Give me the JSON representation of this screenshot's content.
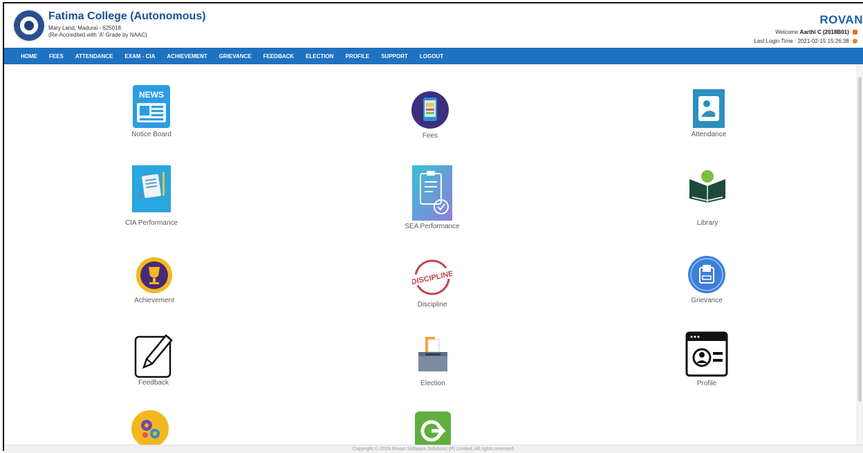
{
  "header": {
    "college_name": "Fatima College (Autonomous)",
    "address_line1": "Mary Land, Madurai - 625018.",
    "address_line2": "(Re-Accredited with 'A' Grade by NAAC)",
    "brand": "ROVAN",
    "welcome_prefix": "Welcome",
    "welcome_user": "Aarthi C (2018B01)",
    "last_login": "Last Login Time : 2021-02-15 15:26:38"
  },
  "nav": [
    "HOME",
    "FEES",
    "ATTENDANCE",
    "EXAM - CIA",
    "ACHIEVEMENT",
    "GRIEVANCE",
    "FEEDBACK",
    "ELECTION",
    "PROFILE",
    "SUPPORT",
    "LOGOUT"
  ],
  "tiles": {
    "notice_board": "Notice Board",
    "fees": "Fees",
    "attendance": "Attendance",
    "cia": "CIA Performance",
    "sea": "SEA Performance",
    "library": "Library",
    "achievement": "Achievement",
    "discipline": "Discipline",
    "grievance": "Grievance",
    "feedback": "Feedback",
    "election": "Election",
    "profile": "Profile"
  },
  "icon_text": {
    "news": "NEWS",
    "discipline": "DISCIPLINE"
  },
  "icons": [
    "news-icon",
    "mobile-payment-icon",
    "attendance-icon",
    "cia-report-icon",
    "clipboard-check-icon",
    "library-book-icon",
    "trophy-icon",
    "discipline-stamp-icon",
    "grievance-box-icon",
    "pencil-edit-icon",
    "ballot-box-icon",
    "profile-card-icon",
    "support-gears-icon",
    "logout-icon"
  ],
  "footer": "Copyright © 2019 Rovan Software Solutions (P) Limited. All rights reserved.",
  "colors": {
    "nav": "#1f72c1",
    "brand": "#1b5fae",
    "college": "#1b4f9a"
  }
}
